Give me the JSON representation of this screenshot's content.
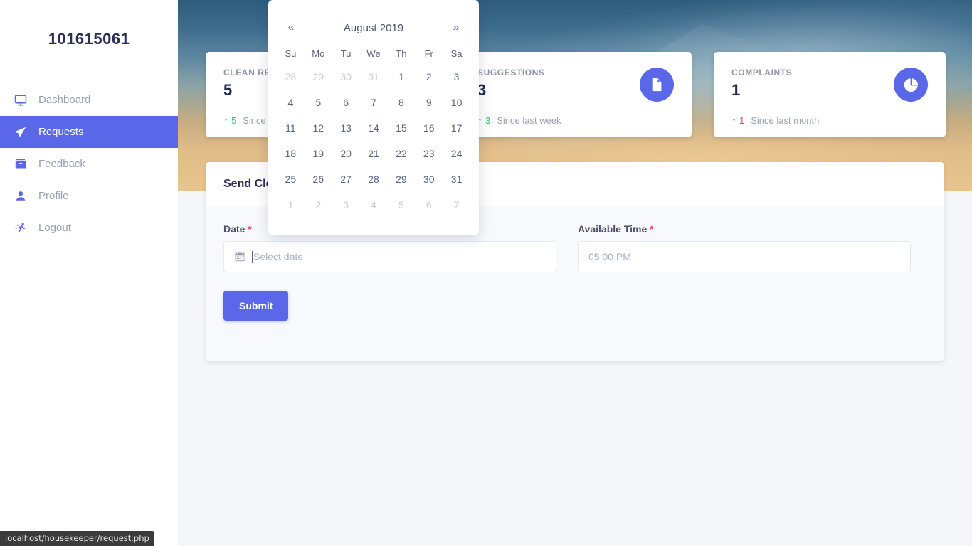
{
  "sidebar": {
    "brand": "101615061",
    "items": [
      {
        "label": "Dashboard",
        "icon": "monitor-icon",
        "active": false
      },
      {
        "label": "Requests",
        "icon": "paper-plane-icon",
        "active": true
      },
      {
        "label": "Feedback",
        "icon": "inbox-icon",
        "active": false
      },
      {
        "label": "Profile",
        "icon": "user-icon",
        "active": false
      },
      {
        "label": "Logout",
        "icon": "running-person-icon",
        "active": false
      }
    ]
  },
  "cards": [
    {
      "title": "CLEAN REQUESTS",
      "value": "5",
      "arrow": "↑",
      "delta": "5",
      "since": "Since last month",
      "trend": "up-green",
      "icon": "clipboard-icon"
    },
    {
      "title": "SUGGESTIONS",
      "value": "3",
      "arrow": "↑",
      "delta": "3",
      "since": "Since last week",
      "trend": "up-green",
      "icon": "document-icon"
    },
    {
      "title": "COMPLAINTS",
      "value": "1",
      "arrow": "↑",
      "delta": "1",
      "since": "Since last month",
      "trend": "up-red",
      "icon": "pie-chart-icon"
    }
  ],
  "panel": {
    "title": "Send Cleaning Request",
    "date_label": "Date",
    "date_required": "*",
    "date_placeholder": "Select date",
    "date_value": "",
    "time_label": "Available Time",
    "time_required": "*",
    "time_placeholder": "05:00 PM",
    "time_value": "",
    "submit_label": "Submit"
  },
  "datepicker": {
    "prev": "«",
    "next": "»",
    "title": "August 2019",
    "dow": [
      "Su",
      "Mo",
      "Tu",
      "We",
      "Th",
      "Fr",
      "Sa"
    ],
    "weeks": [
      [
        {
          "d": "28",
          "m": true
        },
        {
          "d": "29",
          "m": true
        },
        {
          "d": "30",
          "m": true
        },
        {
          "d": "31",
          "m": true
        },
        {
          "d": "1",
          "m": false
        },
        {
          "d": "2",
          "m": false
        },
        {
          "d": "3",
          "m": false
        }
      ],
      [
        {
          "d": "4",
          "m": false
        },
        {
          "d": "5",
          "m": false
        },
        {
          "d": "6",
          "m": false
        },
        {
          "d": "7",
          "m": false
        },
        {
          "d": "8",
          "m": false
        },
        {
          "d": "9",
          "m": false
        },
        {
          "d": "10",
          "m": false
        }
      ],
      [
        {
          "d": "11",
          "m": false
        },
        {
          "d": "12",
          "m": false
        },
        {
          "d": "13",
          "m": false
        },
        {
          "d": "14",
          "m": false
        },
        {
          "d": "15",
          "m": false
        },
        {
          "d": "16",
          "m": false
        },
        {
          "d": "17",
          "m": false
        }
      ],
      [
        {
          "d": "18",
          "m": false
        },
        {
          "d": "19",
          "m": false
        },
        {
          "d": "20",
          "m": false
        },
        {
          "d": "21",
          "m": false
        },
        {
          "d": "22",
          "m": false
        },
        {
          "d": "23",
          "m": false
        },
        {
          "d": "24",
          "m": false
        }
      ],
      [
        {
          "d": "25",
          "m": false
        },
        {
          "d": "26",
          "m": false
        },
        {
          "d": "27",
          "m": false
        },
        {
          "d": "28",
          "m": false
        },
        {
          "d": "29",
          "m": false
        },
        {
          "d": "30",
          "m": false
        },
        {
          "d": "31",
          "m": false
        }
      ],
      [
        {
          "d": "1",
          "m": true
        },
        {
          "d": "2",
          "m": true
        },
        {
          "d": "3",
          "m": true
        },
        {
          "d": "4",
          "m": true
        },
        {
          "d": "5",
          "m": true
        },
        {
          "d": "6",
          "m": true
        },
        {
          "d": "7",
          "m": true
        }
      ]
    ]
  },
  "statusbar": {
    "url": "localhost/housekeeper/request.php"
  },
  "colors": {
    "accent": "#5a67e8",
    "up_green": "#2ecc71",
    "up_red": "#e8456b",
    "heading": "#2b2f56",
    "muted": "#9aa1b1"
  }
}
